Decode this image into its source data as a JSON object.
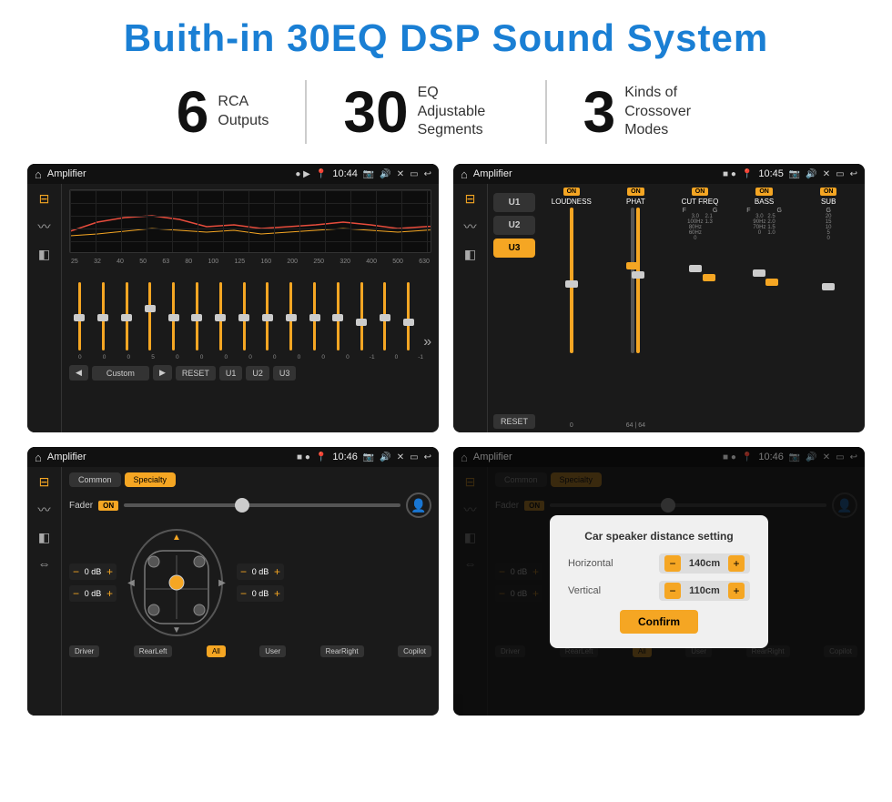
{
  "title": "Buith-in 30EQ DSP Sound System",
  "stats": [
    {
      "number": "6",
      "label_line1": "RCA",
      "label_line2": "Outputs"
    },
    {
      "number": "30",
      "label_line1": "EQ Adjustable",
      "label_line2": "Segments"
    },
    {
      "number": "3",
      "label_line1": "Kinds of",
      "label_line2": "Crossover Modes"
    }
  ],
  "screens": [
    {
      "id": "eq-screen",
      "status": {
        "app": "Amplifier",
        "time": "10:44"
      },
      "eq_freqs": [
        "25",
        "32",
        "40",
        "50",
        "63",
        "80",
        "100",
        "125",
        "160",
        "200",
        "250",
        "320",
        "400",
        "500",
        "630"
      ],
      "eq_values": [
        "0",
        "0",
        "0",
        "5",
        "0",
        "0",
        "0",
        "0",
        "0",
        "0",
        "0",
        "0",
        "-1",
        "0",
        "-1"
      ],
      "preset": "Custom",
      "buttons": [
        "RESET",
        "U1",
        "U2",
        "U3"
      ]
    },
    {
      "id": "crossover-screen",
      "status": {
        "app": "Amplifier",
        "time": "10:45"
      },
      "presets": [
        "U1",
        "U2",
        "U3"
      ],
      "channels": [
        "LOUDNESS",
        "PHAT",
        "CUT FREQ",
        "BASS",
        "SUB"
      ],
      "reset": "RESET"
    },
    {
      "id": "fader-screen",
      "status": {
        "app": "Amplifier",
        "time": "10:46"
      },
      "tabs": [
        "Common",
        "Specialty"
      ],
      "fader_label": "Fader",
      "volumes": [
        "0 dB",
        "0 dB",
        "0 dB",
        "0 dB"
      ],
      "locations": [
        "Driver",
        "RearLeft",
        "All",
        "User",
        "RearRight",
        "Copilot"
      ]
    },
    {
      "id": "distance-screen",
      "status": {
        "app": "Amplifier",
        "time": "10:46"
      },
      "tabs": [
        "Common",
        "Specialty"
      ],
      "dialog": {
        "title": "Car speaker distance setting",
        "horizontal_label": "Horizontal",
        "horizontal_value": "140cm",
        "vertical_label": "Vertical",
        "vertical_value": "110cm",
        "confirm_label": "Confirm"
      }
    }
  ]
}
